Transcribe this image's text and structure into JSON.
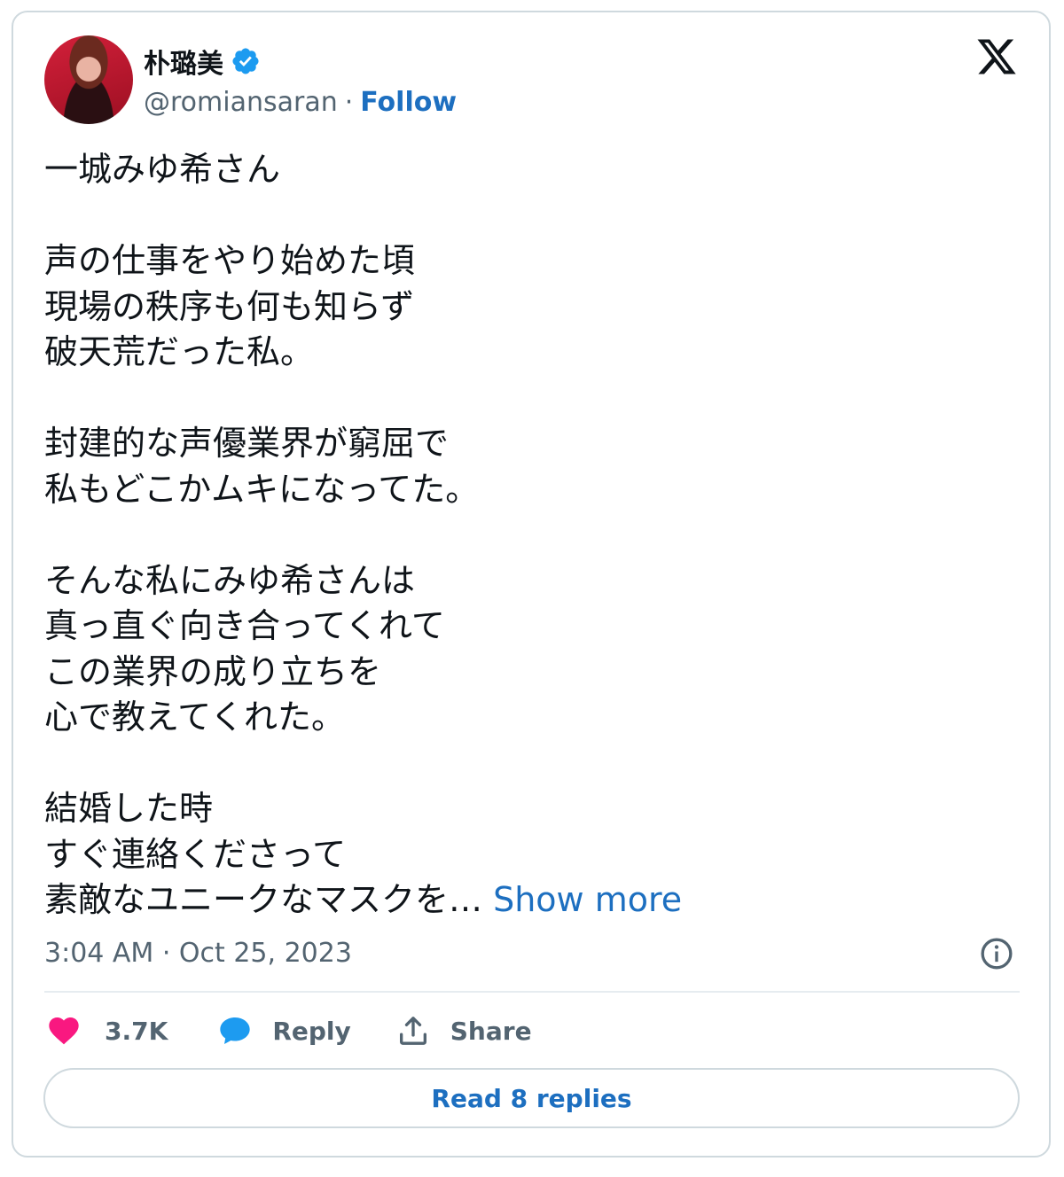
{
  "author": {
    "name": "朴璐美",
    "handle": "@romiansaran",
    "separator": "·",
    "follow_label": "Follow"
  },
  "tweet": {
    "text": "一城みゆ希さん\n\n声の仕事をやり始めた頃\n現場の秩序も何も知らず\n破天荒だった私。\n\n封建的な声優業界が窮屈で\n私もどこかムキになってた。\n\nそんな私にみゆ希さんは\n真っ直ぐ向き合ってくれて\nこの業界の成り立ちを\n心で教えてくれた。\n\n結婚した時\nすぐ連絡くださって\n素敵なユニークなマスクを… ",
    "show_more_label": "Show more",
    "timestamp": "3:04 AM · Oct 25, 2023"
  },
  "actions": {
    "like_count": "3.7K",
    "reply_label": "Reply",
    "share_label": "Share"
  },
  "read_replies_label": "Read 8 replies",
  "colors": {
    "accent": "#1d6fc0",
    "like": "#f91880",
    "reply": "#1d9bf0",
    "muted": "#536471"
  },
  "icons": [
    "verified-badge-icon",
    "x-logo-icon",
    "info-icon",
    "heart-icon",
    "reply-bubble-icon",
    "share-icon"
  ]
}
